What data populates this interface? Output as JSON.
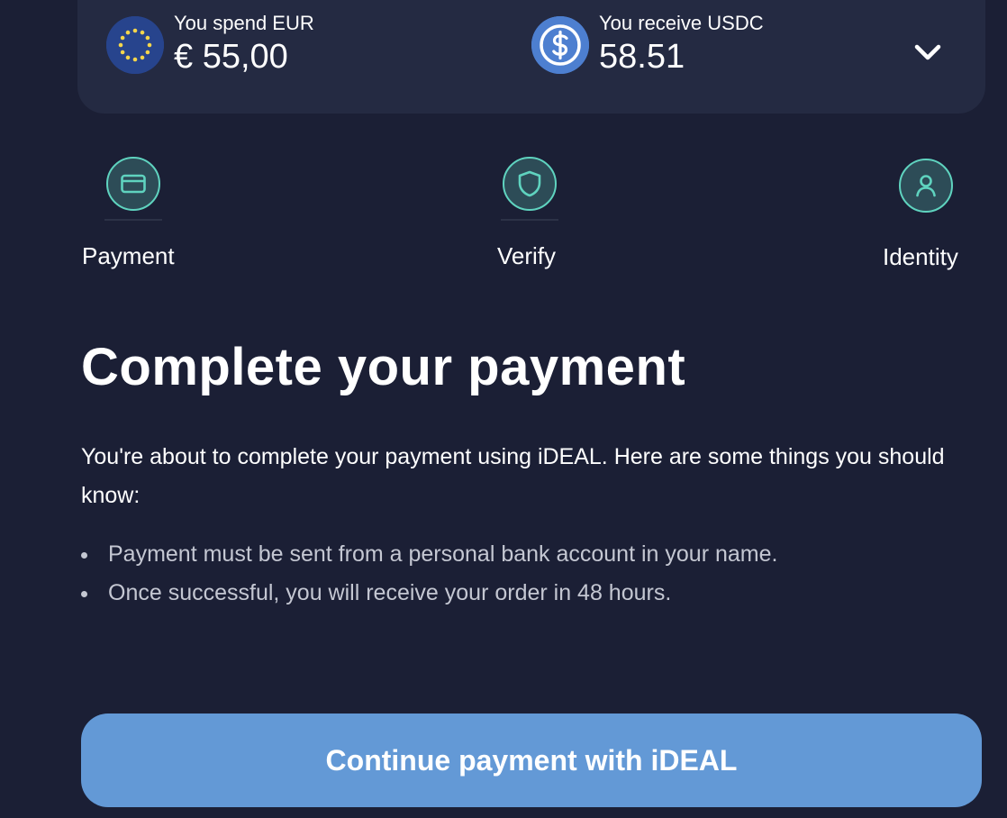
{
  "summary": {
    "spend": {
      "label": "You spend EUR",
      "amount": "€ 55,00",
      "icon": "eur-flag-icon"
    },
    "receive": {
      "label": "You receive USDC",
      "amount": "58.51",
      "icon": "usdc-icon"
    },
    "expand_icon": "chevron-down-icon"
  },
  "steps": [
    {
      "label": "Payment",
      "icon": "card-icon"
    },
    {
      "label": "Verify",
      "icon": "shield-icon"
    },
    {
      "label": "Identity",
      "icon": "user-icon"
    }
  ],
  "main": {
    "title": "Complete your payment",
    "intro": "You're about to complete your payment using iDEAL. Here are some things you should know:",
    "notes": [
      "Payment must be sent from a personal bank account in your name.",
      "Once successful, you will receive your order in 48 hours."
    ]
  },
  "continue_button": {
    "label": "Continue payment with iDEAL"
  },
  "colors": {
    "background": "#1b1f35",
    "card": "#242a42",
    "accent_teal": "#5fd3bf",
    "button": "#6399d6"
  }
}
